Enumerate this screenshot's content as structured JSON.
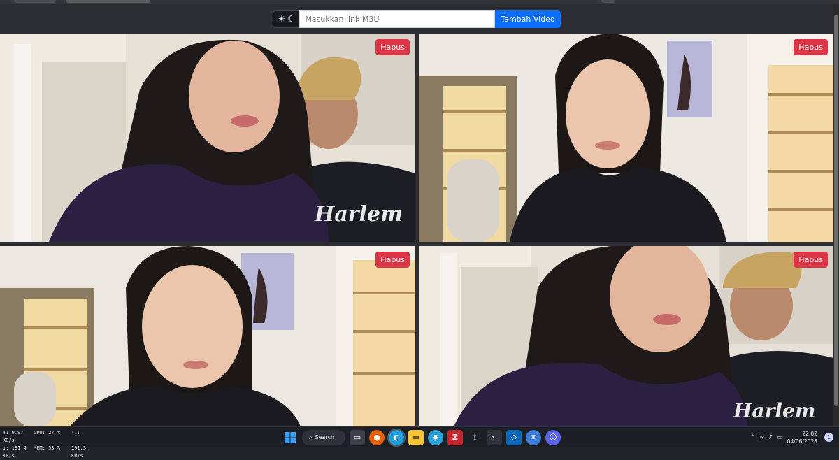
{
  "toolbar": {
    "theme_toggle_icon": "sun-moon-icon",
    "m3u_placeholder": "Masukkan link M3U",
    "add_button_label": "Tambah Video"
  },
  "videos": [
    {
      "delete_label": "Hapus",
      "shirt_text": "Harlem"
    },
    {
      "delete_label": "Hapus"
    },
    {
      "delete_label": "Hapus"
    },
    {
      "delete_label": "Hapus",
      "shirt_text": "Harlem"
    }
  ],
  "colors": {
    "accent_blue": "#0d6efd",
    "danger_red": "#dc3545",
    "page_bg": "#2b2d31"
  },
  "taskbar": {
    "net_stats": {
      "upload": "↑: 9.97 KB/s",
      "download": "↓: 181.4 KB/s",
      "cpu": "CPU: 27 %",
      "mem": "MEM: 53 %",
      "disk_label": "↑↓:",
      "disk_value": "191.3 KB/s"
    },
    "search_label": "Search",
    "apps": [
      "windows-icon",
      "search-icon",
      "file-icon",
      "firefox-icon",
      "edge-icon",
      "file-explorer-icon",
      "globe-icon",
      "filezilla-icon",
      "signal-icon",
      "terminal-icon",
      "vscode-icon",
      "chat-icon",
      "discord-icon"
    ],
    "clock_time": "22:02",
    "clock_date": "04/06/2023",
    "notification_count": "1"
  }
}
